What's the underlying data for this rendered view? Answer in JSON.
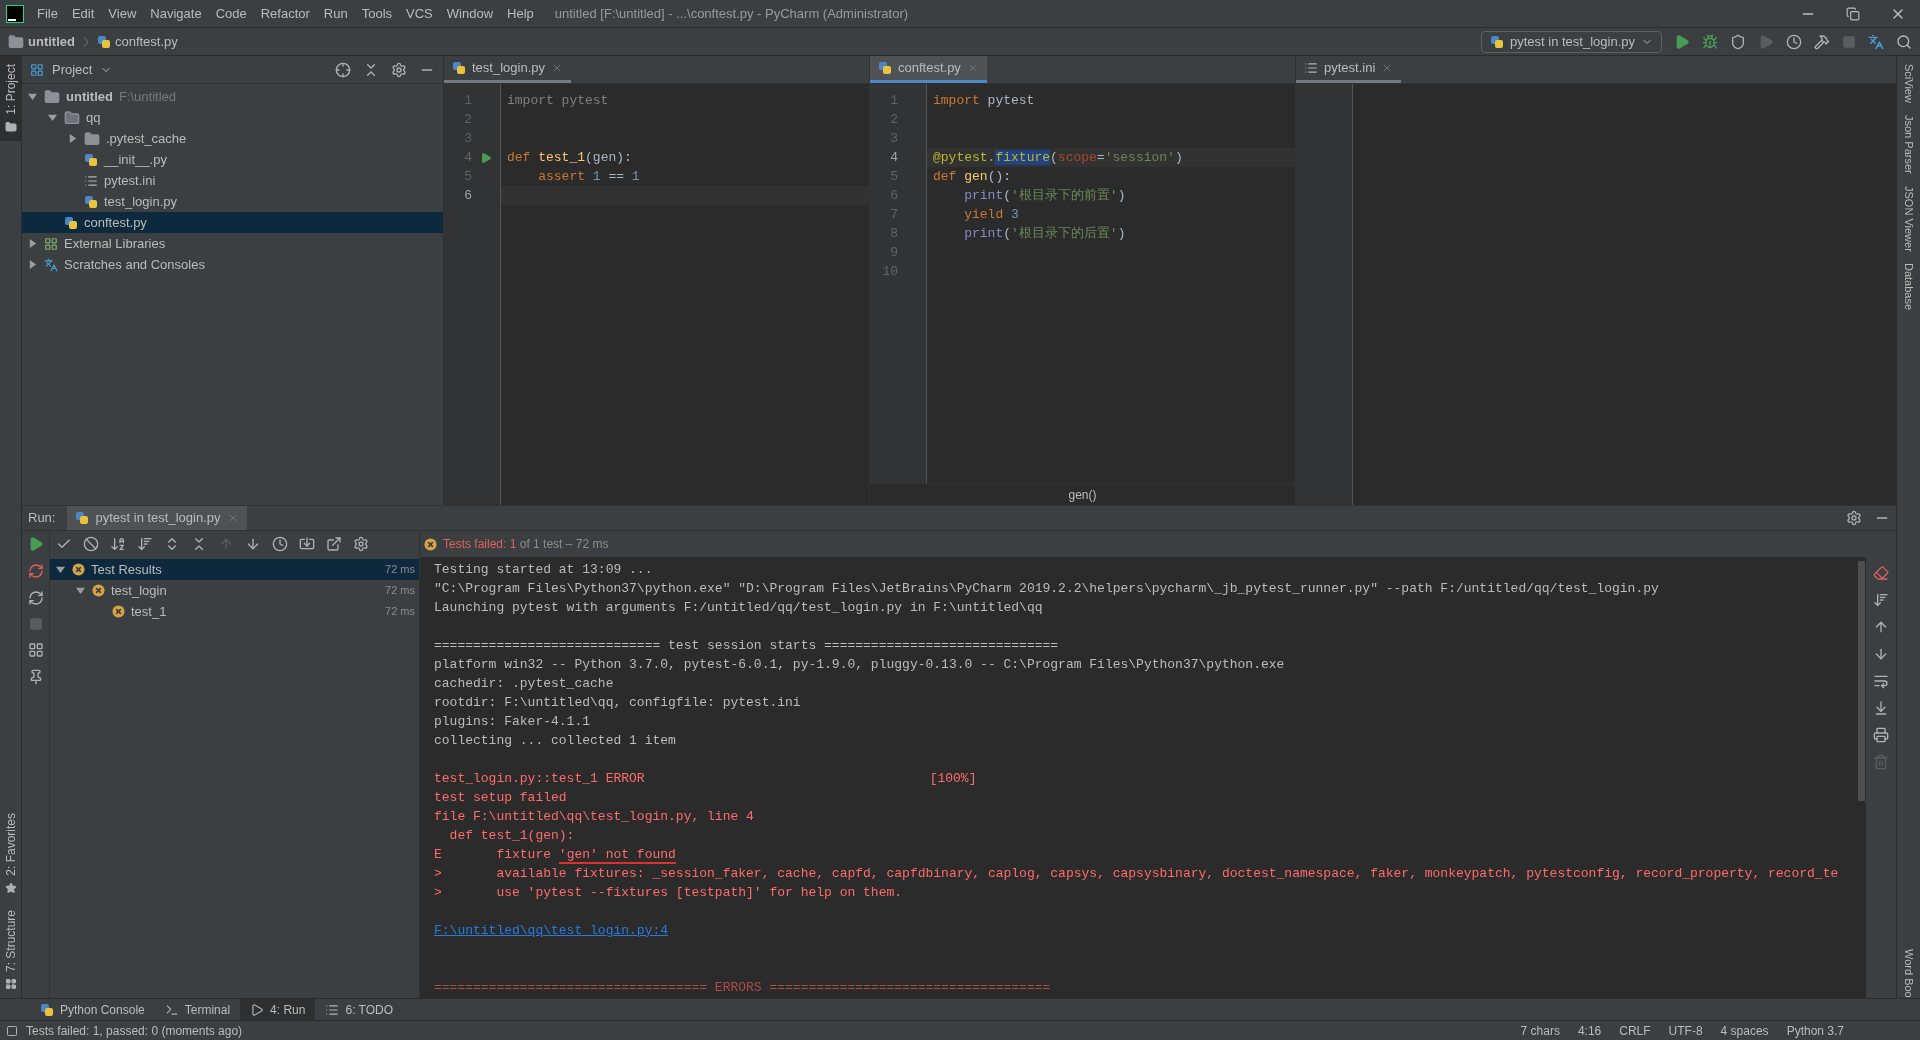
{
  "window": {
    "title": "untitled [F:\\untitled] - ...\\conftest.py - PyCharm (Administrator)"
  },
  "menu": [
    "File",
    "Edit",
    "View",
    "Navigate",
    "Code",
    "Refactor",
    "Run",
    "Tools",
    "VCS",
    "Window",
    "Help"
  ],
  "breadcrumb": [
    "untitled",
    "conftest.py"
  ],
  "run_config": "pytest in test_login.py",
  "left_strip": [
    {
      "label": "1: Project",
      "selected": true,
      "kind": "project"
    },
    {
      "label": "2: Favorites",
      "selected": false,
      "kind": "favorites"
    },
    {
      "label": "7: Structure",
      "selected": false,
      "kind": "structure"
    }
  ],
  "right_strip": [
    "SciView",
    "Json Parser",
    "JSON Viewer",
    "Database",
    "Word Boo"
  ],
  "project": {
    "title": "Project",
    "tree": [
      {
        "label": "untitled",
        "hint": "F:\\untitled",
        "kind": "project-folder",
        "expanded": true,
        "selected": false,
        "children": [
          {
            "label": "qq",
            "kind": "package",
            "expanded": true,
            "selected": false,
            "children": [
              {
                "label": ".pytest_cache",
                "kind": "folder",
                "expanded": false,
                "selected": false
              },
              {
                "label": "__init__.py",
                "kind": "python",
                "selected": false
              },
              {
                "label": "pytest.ini",
                "kind": "ini",
                "selected": false
              },
              {
                "label": "test_login.py",
                "kind": "python",
                "selected": false
              }
            ]
          },
          {
            "label": "conftest.py",
            "kind": "python",
            "selected": true
          }
        ]
      },
      {
        "label": "External Libraries",
        "kind": "libraries",
        "expanded": false,
        "selected": false
      },
      {
        "label": "Scratches and Consoles",
        "kind": "scratches",
        "expanded": false,
        "selected": false
      }
    ]
  },
  "editors": [
    {
      "tab": "test_login.py",
      "kind": "python",
      "selected": false,
      "lines": [
        {
          "n": "1",
          "current": false,
          "run": false,
          "tokens": [
            {
              "kind": "unused",
              "text": "import pytest"
            }
          ]
        },
        {
          "n": "2",
          "current": false,
          "run": false
        },
        {
          "n": "3",
          "current": false,
          "run": false
        },
        {
          "n": "4",
          "current": false,
          "run": true,
          "tokens": [
            {
              "kind": "kw",
              "text": "def "
            },
            {
              "kind": "fn",
              "text": "test_1"
            },
            {
              "kind": "plain",
              "text": "(gen):"
            }
          ]
        },
        {
          "n": "5",
          "current": false,
          "run": false,
          "tokens": [
            {
              "kind": "kw",
              "text": "    assert "
            },
            {
              "kind": "num",
              "text": "1"
            },
            {
              "kind": "plain",
              "text": " == "
            },
            {
              "kind": "num",
              "text": "1"
            }
          ]
        },
        {
          "n": "6",
          "current": true,
          "run": false
        }
      ]
    },
    {
      "tab": "conftest.py",
      "kind": "python",
      "selected": true,
      "footer": "gen()",
      "lines": [
        {
          "n": "1",
          "current": false,
          "tokens": [
            {
              "kind": "kw",
              "text": "import "
            },
            {
              "kind": "plain",
              "text": "pytest"
            }
          ]
        },
        {
          "n": "2",
          "current": false
        },
        {
          "n": "3",
          "current": false
        },
        {
          "n": "4",
          "current": true,
          "tokens": [
            {
              "kind": "deco",
              "text": "@pytest."
            },
            {
              "kind": "deco-sel",
              "text": "fixture"
            },
            {
              "kind": "plain",
              "text": "("
            },
            {
              "kind": "param",
              "text": "scope"
            },
            {
              "kind": "plain",
              "text": "="
            },
            {
              "kind": "str",
              "text": "'session'"
            },
            {
              "kind": "plain",
              "text": ")"
            }
          ]
        },
        {
          "n": "5",
          "current": false,
          "tokens": [
            {
              "kind": "kw",
              "text": "def "
            },
            {
              "kind": "fn",
              "text": "gen"
            },
            {
              "kind": "plain",
              "text": "():"
            }
          ]
        },
        {
          "n": "6",
          "current": false,
          "tokens": [
            {
              "kind": "builtin",
              "text": "    print"
            },
            {
              "kind": "plain",
              "text": "("
            },
            {
              "kind": "str",
              "text": "'根目录下的前置'"
            },
            {
              "kind": "plain",
              "text": ")"
            }
          ]
        },
        {
          "n": "7",
          "current": false,
          "tokens": [
            {
              "kind": "kw",
              "text": "    yield "
            },
            {
              "kind": "num",
              "text": "3"
            }
          ]
        },
        {
          "n": "8",
          "current": false,
          "tokens": [
            {
              "kind": "builtin",
              "text": "    print"
            },
            {
              "kind": "plain",
              "text": "("
            },
            {
              "kind": "str",
              "text": "'根目录下的后置'"
            },
            {
              "kind": "plain",
              "text": ")"
            }
          ]
        },
        {
          "n": "9",
          "current": false
        },
        {
          "n": "10",
          "current": false
        }
      ]
    },
    {
      "tab": "pytest.ini",
      "kind": "ini",
      "selected": false
    }
  ],
  "run": {
    "label": "Run:",
    "tab": "pytest in test_login.py",
    "status_bold": "Tests failed: 1",
    "status_rest": "of 1 test – 72 ms",
    "tree": [
      {
        "label": "Test Results",
        "time": "72 ms",
        "selected": true,
        "children": [
          {
            "label": "test_login",
            "time": "72 ms",
            "selected": false,
            "children": [
              {
                "label": "test_1",
                "time": "72 ms",
                "selected": false
              }
            ]
          }
        ]
      }
    ],
    "console": [
      {
        "kind": "normal",
        "text": "Testing started at 13:09 ..."
      },
      {
        "kind": "normal",
        "text": "\"C:\\Program Files\\Python37\\python.exe\" \"D:\\Program Files\\JetBrains\\PyCharm 2019.2.2\\helpers\\pycharm\\_jb_pytest_runner.py\" --path F:/untitled/qq/test_login.py"
      },
      {
        "kind": "normal",
        "text": "Launching pytest with arguments F:/untitled/qq/test_login.py in F:\\untitled\\qq"
      },
      {
        "kind": "blank"
      },
      {
        "kind": "normal",
        "text": "============================= test session starts =============================="
      },
      {
        "kind": "normal",
        "text": "platform win32 -- Python 3.7.0, pytest-6.0.1, py-1.9.0, pluggy-0.13.0 -- C:\\Program Files\\Python37\\python.exe"
      },
      {
        "kind": "normal",
        "text": "cachedir: .pytest_cache"
      },
      {
        "kind": "normal",
        "text": "rootdir: F:\\untitled\\qq, configfile: pytest.ini"
      },
      {
        "kind": "normal",
        "text": "plugins: Faker-4.1.1"
      },
      {
        "kind": "normal",
        "text": "collecting ... collected 1 item"
      },
      {
        "kind": "blank"
      },
      {
        "kind": "error",
        "text": "test_login.py::test_1 ERROR",
        "right": "[100%]"
      },
      {
        "kind": "error",
        "text": "test setup failed"
      },
      {
        "kind": "error",
        "text": "file F:\\untitled\\qq\\test_login.py, line 4"
      },
      {
        "kind": "error",
        "text": "  def test_1(gen):"
      },
      {
        "kind": "error",
        "segments": [
          {
            "text": "E       fixture ",
            "marked": false
          },
          {
            "text": "'gen' not found",
            "marked": true
          }
        ]
      },
      {
        "kind": "error",
        "text": ">       available fixtures: _session_faker, cache, capfd, capfdbinary, caplog, capsys, capsysbinary, doctest_namespace, faker, monkeypatch, pytestconfig, record_property, record_te"
      },
      {
        "kind": "error",
        "text": ">       use 'pytest --fixtures [testpath]' for help on them."
      },
      {
        "kind": "blank"
      },
      {
        "kind": "link",
        "text": "F:\\untitled\\qq\\test_login.py:4"
      },
      {
        "kind": "blank"
      },
      {
        "kind": "blank"
      },
      {
        "kind": "rule",
        "text": "=================================== ERRORS ===================================="
      }
    ]
  },
  "bottom_tabs": [
    {
      "label": "Python Console",
      "kind": "python",
      "selected": false
    },
    {
      "label": "Terminal",
      "kind": "terminal",
      "selected": false
    },
    {
      "label": "4: Run",
      "kind": "run",
      "selected": true
    },
    {
      "label": "6: TODO",
      "kind": "todo",
      "selected": false
    }
  ],
  "status_bar": {
    "message": "Tests failed: 1, passed: 0 (moments ago)",
    "items": [
      "7 chars",
      "4:16",
      "CRLF",
      "UTF-8",
      "4 spaces",
      "Python 3.7"
    ]
  }
}
